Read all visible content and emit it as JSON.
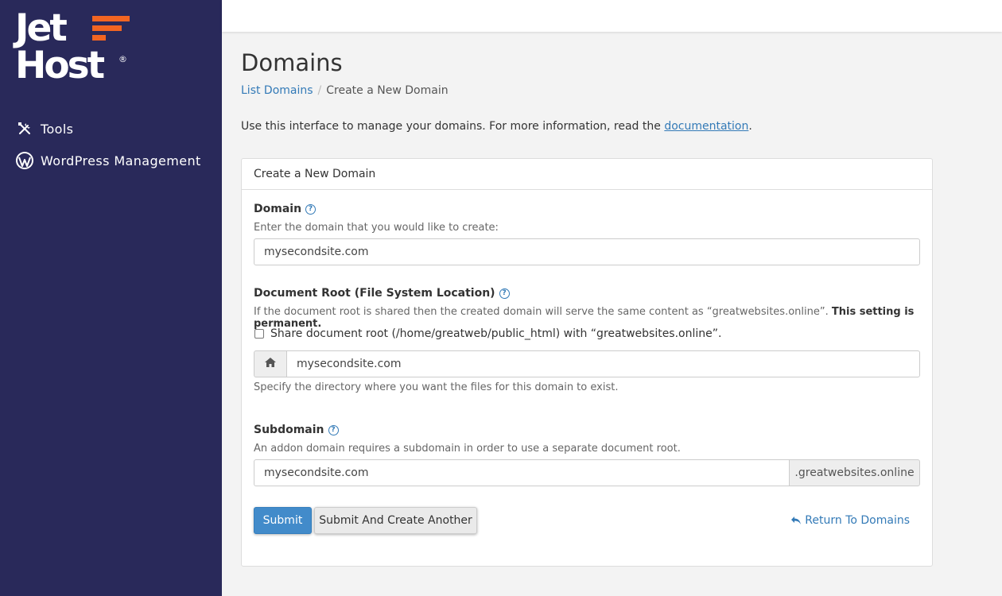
{
  "brand": {
    "line1": "Jet",
    "line2": "Host",
    "reg": "®",
    "accent": "#f26522",
    "sidebar_bg": "#29295a"
  },
  "sidebar": {
    "items": [
      {
        "label": "Tools",
        "icon": "tools-icon"
      },
      {
        "label": "WordPress Management",
        "icon": "wordpress-icon"
      }
    ]
  },
  "page": {
    "title": "Domains",
    "breadcrumb": {
      "parent": "List Domains",
      "current": "Create a New Domain"
    },
    "intro_text": "Use this interface to manage your domains. For more information, read the ",
    "intro_link": "documentation",
    "intro_end": "."
  },
  "form": {
    "panel_title": "Create a New Domain",
    "domain": {
      "label": "Domain",
      "hint": "Enter the domain that you would like to create:",
      "value": "mysecondsite.com"
    },
    "docroot": {
      "label": "Document Root (File System Location)",
      "hint": "If the document root is shared then the created domain will serve the same content as “greatwebsites.online”. ",
      "hint_bold": "This setting is permanent.",
      "share_label": "Share document root (/home/greatweb/public_html) with “greatwebsites.online”.",
      "share_checked": false,
      "value": "mysecondsite.com",
      "help_text": "Specify the directory where you want the files for this domain to exist."
    },
    "subdomain": {
      "label": "Subdomain",
      "hint": "An addon domain requires a subdomain in order to use a separate document root.",
      "value": "mysecondsite.com",
      "suffix": ".greatwebsites.online"
    },
    "buttons": {
      "submit": "Submit",
      "submit_another": "Submit And Create Another",
      "return": "Return To Domains"
    }
  }
}
